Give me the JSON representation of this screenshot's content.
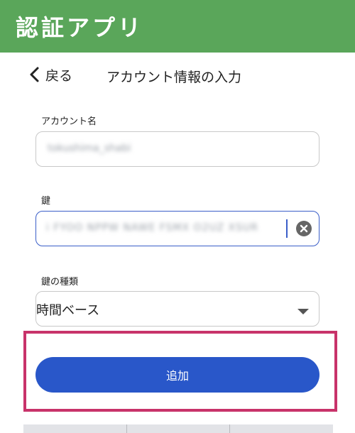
{
  "app_bar": {
    "title": "認証アプリ",
    "color": "#5aa65a"
  },
  "nav": {
    "back_label": "戻る",
    "back_icon": "chevron-left-icon",
    "title": "アカウント情報の入力"
  },
  "form": {
    "account_name": {
      "label": "アカウント名",
      "value": "tokushima_shabi"
    },
    "key": {
      "label": "鍵",
      "value": "i FYOO NPPW NAWE FSMX O2UZ XSUR",
      "clear_icon": "clear-circle-icon"
    },
    "key_type": {
      "label": "鍵の種類",
      "selected": "時間ベース",
      "dropdown_icon": "caret-down-icon"
    },
    "submit_label": "追加"
  },
  "colors": {
    "accent": "#2957c9",
    "highlight": "#c8336a",
    "focus": "#3a5ec8"
  }
}
